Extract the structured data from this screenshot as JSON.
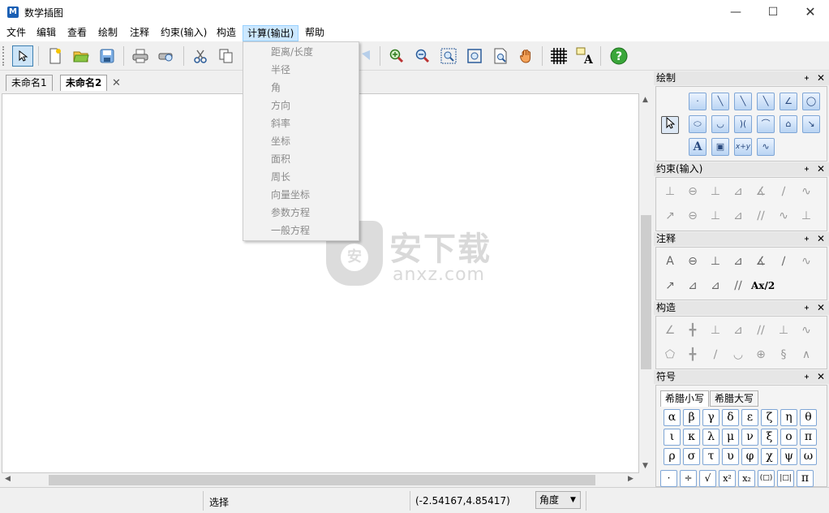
{
  "window": {
    "title": "数学插图",
    "icon_label": "M",
    "controls": {
      "minimize": "—",
      "maximize": "☐",
      "close": "✕"
    }
  },
  "menu": [
    "文件",
    "编辑",
    "查看",
    "绘制",
    "注释",
    "约束(输入)",
    "构造",
    "计算(输出)",
    "帮助"
  ],
  "active_menu": "计算(输出)",
  "dropdown": {
    "items": [
      "距离/长度",
      "半径",
      "角",
      "方向",
      "斜率",
      "坐标",
      "面积",
      "周长",
      "向量坐标",
      "参数方程",
      "一般方程"
    ]
  },
  "toolbar_icons": [
    "pointer-icon",
    "new-icon",
    "open-icon",
    "save-icon",
    "print-icon",
    "print-preview-icon",
    "cut-icon",
    "copy-icon",
    "zoom-in-icon",
    "zoom-out-icon",
    "zoom-box-icon",
    "zoom-fit-icon",
    "zoom-page-icon",
    "pan-hand-icon",
    "grid-icon",
    "text-style-icon",
    "help-icon"
  ],
  "tabs": [
    "未命名1",
    "未命名2"
  ],
  "active_tab": "未命名2",
  "watermark": {
    "text": "安下载",
    "sub": "anxz.com",
    "shield_glyph": "安"
  },
  "panels": {
    "draw": {
      "title": "绘制",
      "text_tool_label": "A",
      "formula_tool_label": "x+y"
    },
    "constraint": {
      "title": "约束(输入)"
    },
    "annotation": {
      "title": "注释",
      "label_tool": "A",
      "fraction_tool": "Ax/2"
    },
    "construct": {
      "title": "构造"
    },
    "symbols": {
      "title": "符号",
      "tabs": [
        "希腊小写",
        "希腊大写"
      ],
      "active_tab": "希腊小写",
      "greek": [
        "α",
        "β",
        "γ",
        "δ",
        "ε",
        "ζ",
        "η",
        "θ",
        "ι",
        "κ",
        "λ",
        "μ",
        "ν",
        "ξ",
        "ο",
        "π",
        "ρ",
        "σ",
        "τ",
        "υ",
        "φ",
        "χ",
        "ψ",
        "ω"
      ],
      "bottom_row": [
        "·",
        "÷",
        "√",
        "x²",
        "x₂",
        "(□)",
        "|□|",
        "π"
      ]
    }
  },
  "panel_controls": {
    "pin": "ᚐ",
    "close": "✕"
  },
  "status": {
    "mode": "选择",
    "coordinates": "(-2.54167,4.85417)",
    "unit_select": "角度"
  }
}
